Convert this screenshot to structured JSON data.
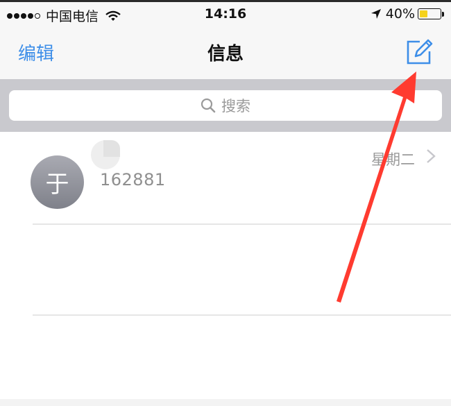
{
  "status_bar": {
    "carrier": "中国电信",
    "time": "14:16",
    "battery_percent": "40%",
    "battery_level": 0.4,
    "icons": [
      "signal-dots-icon",
      "wifi-icon",
      "location-arrow-icon",
      "battery-icon"
    ]
  },
  "nav": {
    "edit_label": "编辑",
    "title": "信息",
    "compose_icon": "compose-icon"
  },
  "search": {
    "placeholder": "搜索",
    "icon": "search-icon"
  },
  "messages": [
    {
      "avatar_letter": "于",
      "sender": "162881",
      "date": "星期二",
      "chevron": "chevron-right-icon"
    }
  ],
  "colors": {
    "accent": "#3d8ee8",
    "annotation_arrow": "#ff3b30",
    "battery": "#f5d21c"
  }
}
